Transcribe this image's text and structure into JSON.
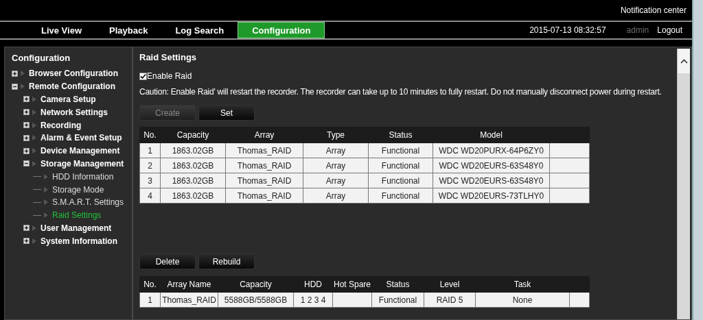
{
  "top_bar": {
    "notification_link": "Notification center"
  },
  "tabs": [
    {
      "label": "Live View",
      "selected": false
    },
    {
      "label": "Playback",
      "selected": false
    },
    {
      "label": "Log Search",
      "selected": false
    },
    {
      "label": "Configuration",
      "selected": true
    }
  ],
  "session": {
    "datetime": "2015-07-13 08:32:57",
    "user": "admin",
    "logout": "Logout"
  },
  "sidebar": {
    "title": "Configuration",
    "items": [
      {
        "label": "Browser Configuration",
        "expanded": false,
        "selected": false
      },
      {
        "label": "Remote Configuration",
        "expanded": true,
        "selected": false,
        "children": [
          {
            "label": "Camera Setup",
            "expanded": false,
            "selected": false
          },
          {
            "label": "Network Settings",
            "expanded": false,
            "selected": false
          },
          {
            "label": "Recording",
            "expanded": false,
            "selected": false
          },
          {
            "label": "Alarm & Event Setup",
            "expanded": false,
            "selected": false
          },
          {
            "label": "Device Management",
            "expanded": false,
            "selected": false
          },
          {
            "label": "Storage Management",
            "expanded": true,
            "selected": false,
            "children": [
              {
                "label": "HDD Information",
                "selected": false
              },
              {
                "label": "Storage Mode",
                "selected": false
              },
              {
                "label": "S.M.A.R.T. Settings",
                "selected": false
              },
              {
                "label": "Raid Settings",
                "selected": true
              }
            ]
          },
          {
            "label": "User Management",
            "expanded": false,
            "selected": false
          },
          {
            "label": "System Information",
            "expanded": false,
            "selected": false
          }
        ]
      }
    ]
  },
  "main": {
    "title": "Raid Settings",
    "enable_raid": {
      "label": "Enable Raid",
      "checked": true
    },
    "caution": "Caution: Enable Raid' will restart the recorder. The recorder can take up to 10 minutes to fully restart. Do not manually disconnect power during restart.",
    "disk_buttons": [
      {
        "label": "Create",
        "disabled": true
      },
      {
        "label": "Set",
        "disabled": false
      }
    ],
    "disk_table": {
      "columns": [
        "No.",
        "Capacity",
        "Array",
        "Type",
        "Status",
        "Model",
        ""
      ],
      "rows": [
        [
          "1",
          "1863.02GB",
          "Thomas_RAID",
          "Array",
          "Functional",
          "WDC WD20PURX-64P6ZY0",
          ""
        ],
        [
          "2",
          "1863.02GB",
          "Thomas_RAID",
          "Array",
          "Functional",
          "WDC WD20EURS-63S48Y0",
          ""
        ],
        [
          "3",
          "1863.02GB",
          "Thomas_RAID",
          "Array",
          "Functional",
          "WDC WD20EURS-63S48Y0",
          ""
        ],
        [
          "4",
          "1863.02GB",
          "Thomas_RAID",
          "Array",
          "Functional",
          "WDC WD20EURS-73TLHY0",
          ""
        ]
      ]
    },
    "array_buttons": [
      {
        "label": "Delete",
        "disabled": false
      },
      {
        "label": "Rebuild",
        "disabled": false
      }
    ],
    "array_table": {
      "columns": [
        "No.",
        "Array Name",
        "Capacity",
        "HDD",
        "Hot Spare",
        "Status",
        "Level",
        "Task",
        ""
      ],
      "rows": [
        [
          "1",
          "Thomas_RAID",
          "5588GB/5588GB",
          "1 2 3 4",
          "",
          "Functional",
          "RAID 5",
          "None",
          ""
        ]
      ]
    }
  }
}
